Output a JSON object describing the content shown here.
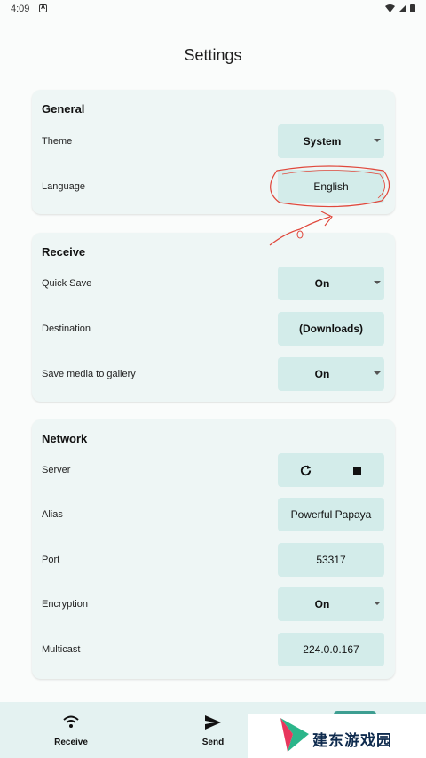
{
  "status_bar": {
    "time": "4:09",
    "notification_icon": "a-notification-icon",
    "icons": [
      "wifi-icon",
      "signal-icon",
      "battery-icon"
    ]
  },
  "page": {
    "title": "Settings"
  },
  "general": {
    "title": "General",
    "theme": {
      "label": "Theme",
      "value": "System"
    },
    "language": {
      "label": "Language",
      "value": "English"
    }
  },
  "receive": {
    "title": "Receive",
    "quick_save": {
      "label": "Quick Save",
      "value": "On"
    },
    "destination": {
      "label": "Destination",
      "value": "(Downloads)"
    },
    "save_media": {
      "label": "Save media to gallery",
      "value": "On"
    }
  },
  "network": {
    "title": "Network",
    "server": {
      "label": "Server",
      "icons": [
        "refresh-icon",
        "stop-icon"
      ]
    },
    "alias": {
      "label": "Alias",
      "value": "Powerful Papaya"
    },
    "port": {
      "label": "Port",
      "value": "53317"
    },
    "encryption": {
      "label": "Encryption",
      "value": "On"
    },
    "multicast": {
      "label": "Multicast",
      "value": "224.0.0.167"
    }
  },
  "bottom_nav": {
    "receive_label": "Receive",
    "send_label": "Send"
  },
  "watermark": {
    "text": "建东游戏园"
  },
  "colors": {
    "card_bg": "#eef6f5",
    "control_bg": "#d3ecea",
    "accent": "#3d9e91",
    "annotation": "#e0483c"
  }
}
